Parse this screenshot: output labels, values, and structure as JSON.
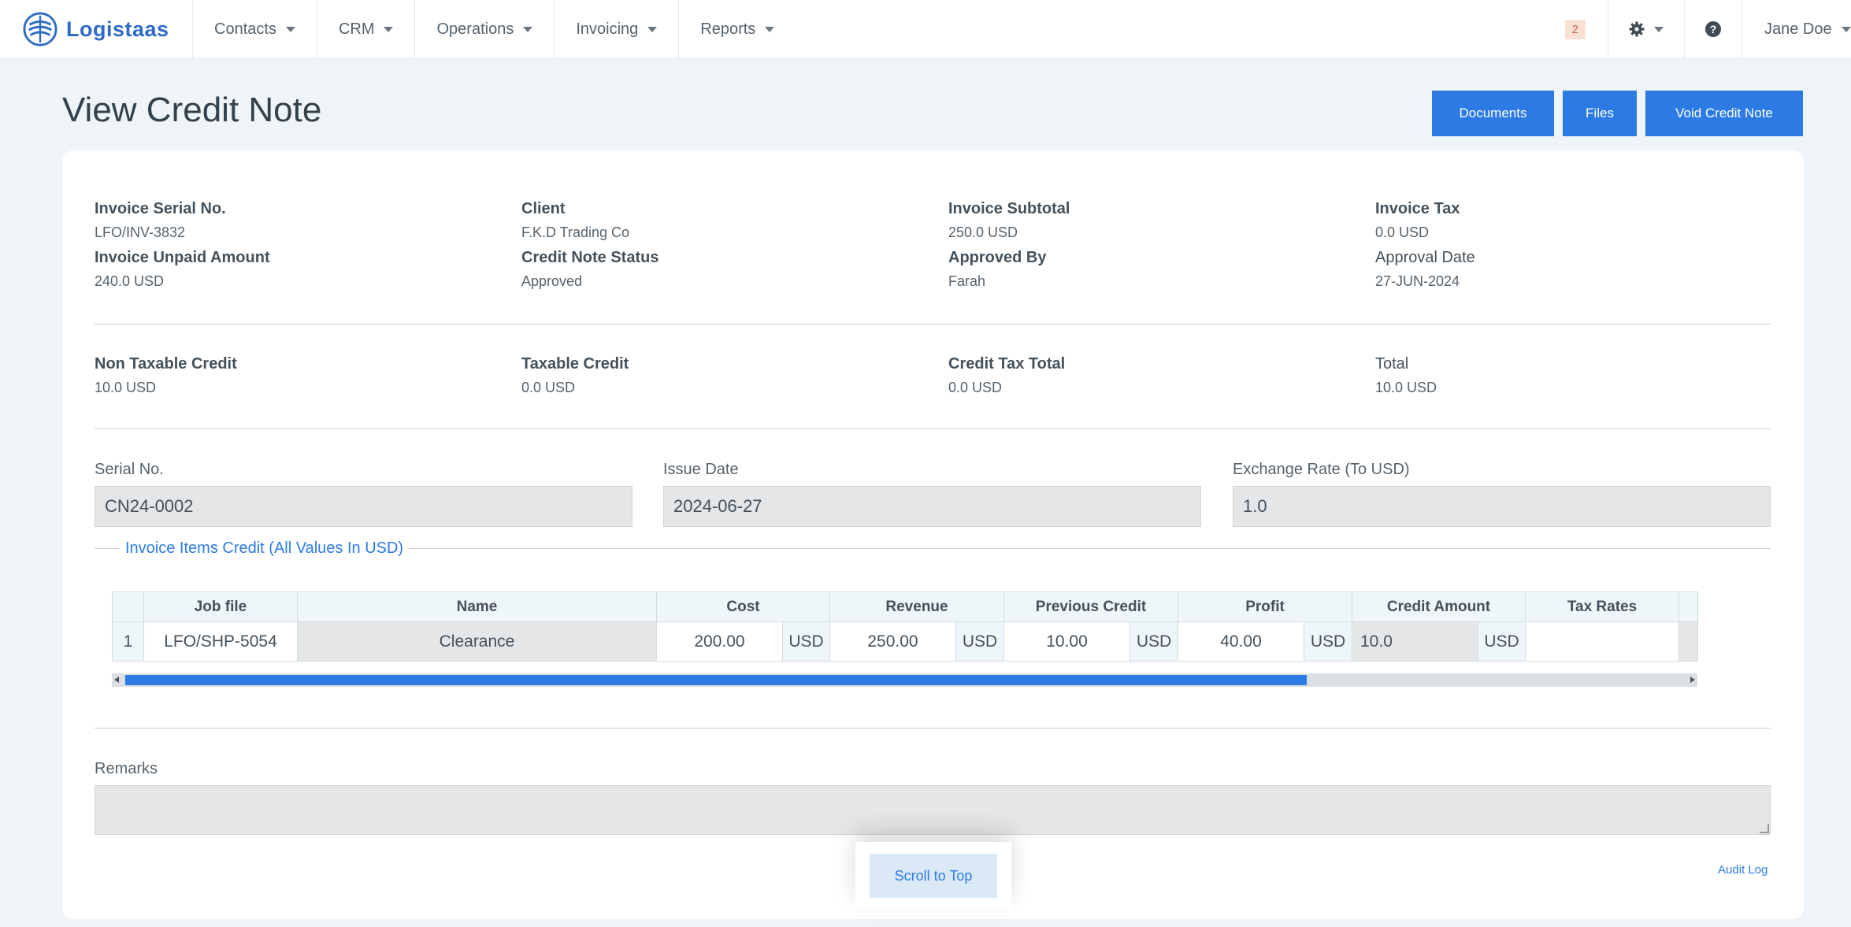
{
  "nav": {
    "brand": "Logistaas",
    "items": [
      "Contacts",
      "CRM",
      "Operations",
      "Invoicing",
      "Reports"
    ],
    "notification_count": "2",
    "user_name": "Jane Doe"
  },
  "page": {
    "title": "View Credit Note",
    "buttons": {
      "documents": "Documents",
      "files": "Files",
      "void": "Void Credit Note"
    }
  },
  "summary": {
    "invoice_serial_label": "Invoice Serial No.",
    "invoice_serial": "LFO/INV-3832",
    "client_label": "Client",
    "client": "F.K.D Trading Co",
    "subtotal_label": "Invoice Subtotal",
    "subtotal": "250.0 USD",
    "tax_label": "Invoice Tax",
    "tax": "0.0 USD",
    "unpaid_label": "Invoice Unpaid Amount",
    "unpaid": "240.0 USD",
    "status_label": "Credit Note Status",
    "status": "Approved",
    "approved_by_label": "Approved By",
    "approved_by": "Farah",
    "approval_date_label": "Approval Date",
    "approval_date": "27-JUN-2024"
  },
  "totals": {
    "non_taxable_label": "Non Taxable Credit",
    "non_taxable": "10.0 USD",
    "taxable_label": "Taxable Credit",
    "taxable": "0.0 USD",
    "credit_tax_label": "Credit Tax Total",
    "credit_tax": "0.0 USD",
    "total_label": "Total",
    "total": "10.0 USD"
  },
  "form": {
    "serial_label": "Serial No.",
    "serial": "CN24-0002",
    "issue_date_label": "Issue Date",
    "issue_date": "2024-06-27",
    "exchange_label": "Exchange Rate (To USD)",
    "exchange": "1.0"
  },
  "items": {
    "legend": "Invoice Items Credit (All Values In USD)",
    "columns": [
      "Job file",
      "Name",
      "Cost",
      "Revenue",
      "Previous Credit",
      "Profit",
      "Credit Amount",
      "Tax Rates"
    ],
    "rows": [
      {
        "index": "1",
        "job_file": "LFO/SHP-5054",
        "name": "Clearance",
        "cost": "200.00",
        "revenue": "250.00",
        "previous_credit": "10.00",
        "profit": "40.00",
        "credit_amount": "10.0",
        "tax_rates": "",
        "currency": "USD"
      }
    ]
  },
  "remarks": {
    "label": "Remarks",
    "value": ""
  },
  "footer": {
    "scroll_top": "Scroll to Top",
    "audit_log": "Audit Log"
  },
  "icons": [
    "logo-icon",
    "gear-icon",
    "help-icon",
    "chevron-down-icon"
  ]
}
